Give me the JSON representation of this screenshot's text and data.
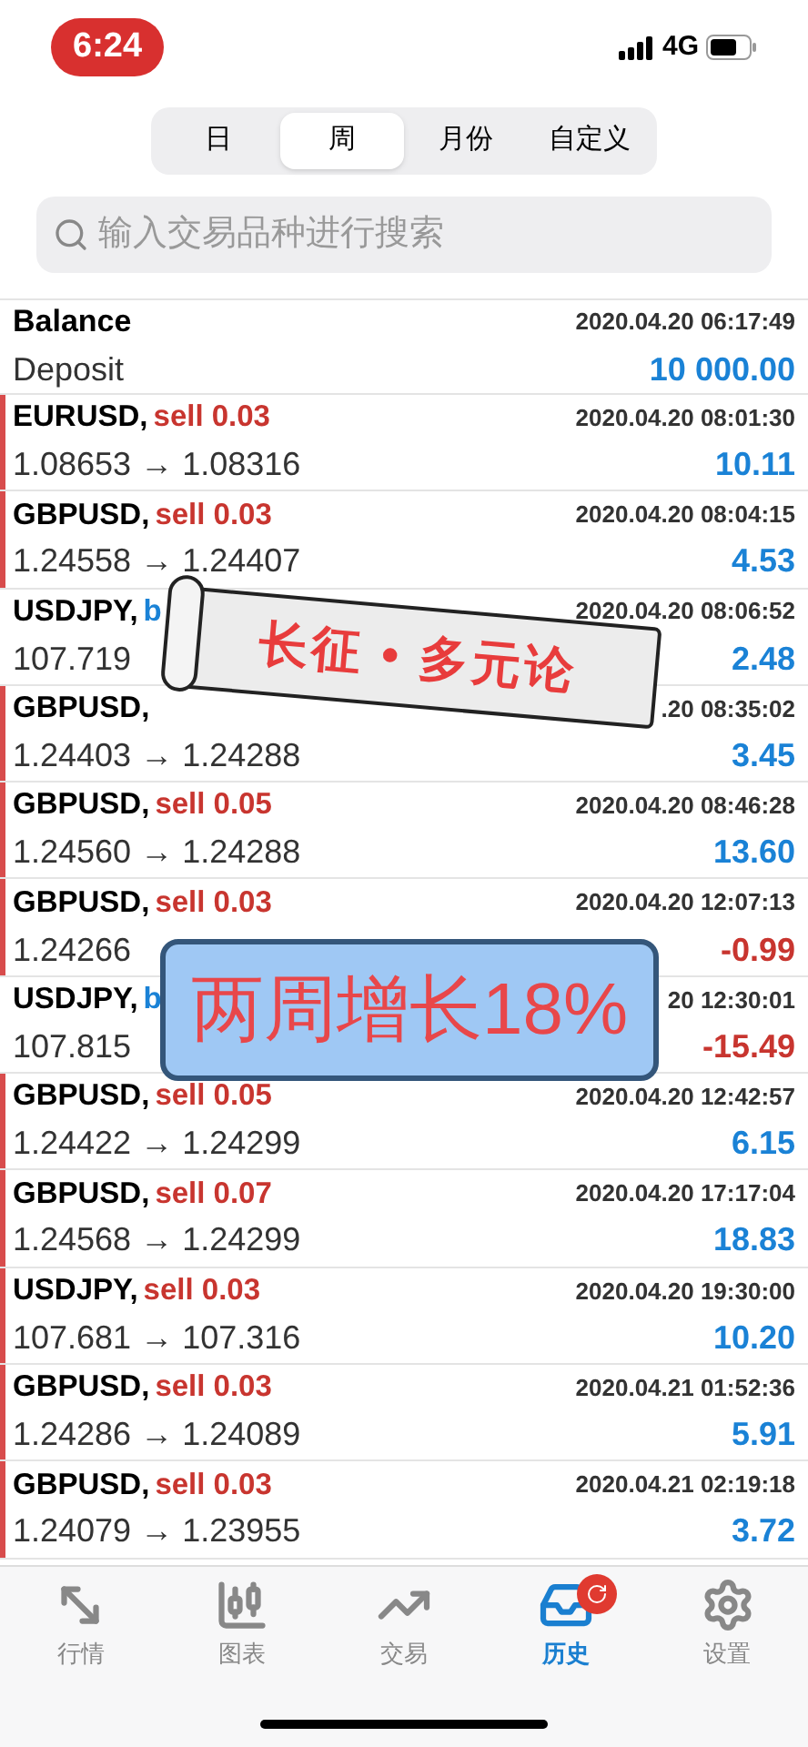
{
  "status_bar": {
    "time": "6:24",
    "network": "4G"
  },
  "period_tabs": [
    {
      "label": "日",
      "selected": false
    },
    {
      "label": "周",
      "selected": true
    },
    {
      "label": "月份",
      "selected": false
    },
    {
      "label": "自定义",
      "selected": false
    }
  ],
  "search": {
    "placeholder": "输入交易品种进行搜索"
  },
  "balance": {
    "title": "Balance",
    "subtitle": "Deposit",
    "time": "2020.04.20 06:17:49",
    "amount": "10 000.00"
  },
  "deals": [
    {
      "symbol": "EURUSD,",
      "kind": "sell",
      "side": "sell 0.03",
      "prices": "1.08653 → 1.08316",
      "time": "2020.04.20 08:01:30",
      "profit": "10.11",
      "loss": false
    },
    {
      "symbol": "GBPUSD,",
      "kind": "sell",
      "side": "sell 0.03",
      "prices": "1.24558 → 1.24407",
      "time": "2020.04.20 08:04:15",
      "profit": "4.53",
      "loss": false
    },
    {
      "symbol": "USDJPY,",
      "kind": "buy",
      "side": "b",
      "prices": "107.719",
      "time": "2020.04.20 08:06:52",
      "profit": "2.48",
      "loss": false
    },
    {
      "symbol": "GBPUSD,",
      "kind": "sell",
      "prices": "1.24403 → 1.24288",
      "time": ".20 08:35:02",
      "profit": "3.45",
      "loss": false
    },
    {
      "symbol": "GBPUSD,",
      "kind": "sell",
      "side": "sell 0.05",
      "prices": "1.24560 → 1.24288",
      "time": "2020.04.20 08:46:28",
      "profit": "13.60",
      "loss": false
    },
    {
      "symbol": "GBPUSD,",
      "kind": "sell",
      "side": "sell 0.03",
      "prices": "1.24266",
      "time": "2020.04.20 12:07:13",
      "profit": "-0.99",
      "loss": true
    },
    {
      "symbol": "USDJPY,",
      "kind": "buy",
      "side": "b",
      "prices": "107.815",
      "time": "20 12:30:01",
      "profit": "-15.49",
      "loss": true
    },
    {
      "symbol": "GBPUSD,",
      "kind": "sell",
      "side": "sell 0.05",
      "prices": "1.24422 → 1.24299",
      "time": "2020.04.20 12:42:57",
      "profit": "6.15",
      "loss": false
    },
    {
      "symbol": "GBPUSD,",
      "kind": "sell",
      "side": "sell 0.07",
      "prices": "1.24568 → 1.24299",
      "time": "2020.04.20 17:17:04",
      "profit": "18.83",
      "loss": false
    },
    {
      "symbol": "USDJPY,",
      "kind": "sell",
      "side": "sell 0.03",
      "prices": "107.681 → 107.316",
      "time": "2020.04.20 19:30:00",
      "profit": "10.20",
      "loss": false
    },
    {
      "symbol": "GBPUSD,",
      "kind": "sell",
      "side": "sell 0.03",
      "prices": "1.24286 → 1.24089",
      "time": "2020.04.21 01:52:36",
      "profit": "5.91",
      "loss": false
    },
    {
      "symbol": "GBPUSD,",
      "kind": "sell",
      "side": "sell 0.03",
      "prices": "1.24079 → 1.23955",
      "time": "2020.04.21 02:19:18",
      "profit": "3.72",
      "loss": false
    }
  ],
  "stickers": [
    {
      "kind": "scroll",
      "text": "长征 • 多元论"
    },
    {
      "kind": "label",
      "text": "两周增长18%"
    }
  ],
  "bottom_nav": [
    {
      "kind": "quotes",
      "label": "行情",
      "selected": false
    },
    {
      "kind": "chart",
      "label": "图表",
      "selected": false
    },
    {
      "kind": "trade",
      "label": "交易",
      "selected": false
    },
    {
      "kind": "history",
      "label": "历史",
      "selected": true,
      "badge": true
    },
    {
      "kind": "settings",
      "label": "设置",
      "selected": false
    }
  ]
}
